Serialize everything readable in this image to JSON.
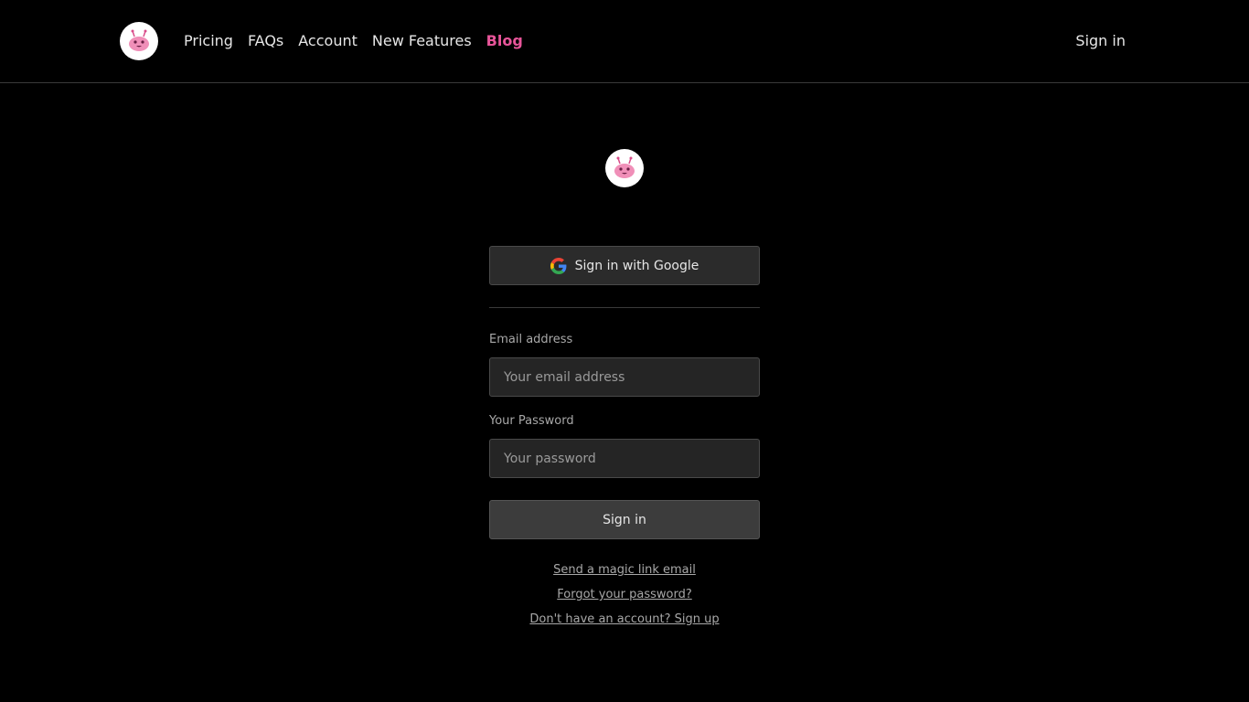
{
  "header": {
    "logo_icon": "robot-mascot-icon",
    "nav": [
      {
        "label": "Pricing"
      },
      {
        "label": "FAQs"
      },
      {
        "label": "Account"
      },
      {
        "label": "New Features"
      },
      {
        "label": "Blog"
      }
    ],
    "active_nav": "Blog",
    "sign_in_label": "Sign in"
  },
  "auth": {
    "logo_icon": "robot-mascot-icon",
    "google_button_label": "Sign in with Google",
    "email_label": "Email address",
    "email_placeholder": "Your email address",
    "email_value": "",
    "password_label": "Your Password",
    "password_placeholder": "Your password",
    "password_value": "",
    "submit_label": "Sign in",
    "links": {
      "magic_link": "Send a magic link email",
      "forgot_password": "Forgot your password?",
      "sign_up": "Don't have an account? Sign up"
    }
  },
  "colors": {
    "background": "#000000",
    "accent": "#e8559a",
    "button": "#2b2b2b",
    "input": "#252525"
  }
}
